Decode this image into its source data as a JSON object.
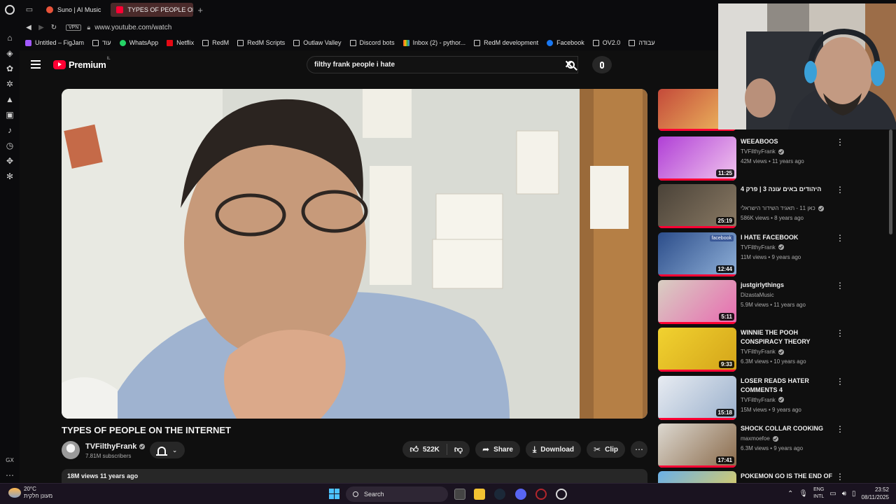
{
  "browser": {
    "tabs": [
      {
        "label": "Suno | AI Music",
        "active": false
      },
      {
        "label": "TYPES OF PEOPLE ON THE INTERNET",
        "active": true
      }
    ],
    "url": "www.youtube.com/watch",
    "vpn_label": "VPN",
    "sidebar_bottom_label": "GX",
    "bookmarks": [
      {
        "label": "Untitled – FigJam",
        "icon": "figjam-icon"
      },
      {
        "label": "עוד",
        "icon": "folder-icon"
      },
      {
        "label": "WhatsApp",
        "icon": "whatsapp-icon"
      },
      {
        "label": "Netflix",
        "icon": "netflix-icon"
      },
      {
        "label": "RedM",
        "icon": "folder-icon"
      },
      {
        "label": "RedM Scripts",
        "icon": "folder-icon"
      },
      {
        "label": "Outlaw Valley",
        "icon": "folder-icon"
      },
      {
        "label": "Discord bots",
        "icon": "folder-icon"
      },
      {
        "label": "Inbox (2) - pythor...",
        "icon": "gmail-icon"
      },
      {
        "label": "RedM development",
        "icon": "folder-icon"
      },
      {
        "label": "Facebook",
        "icon": "facebook-icon"
      },
      {
        "label": "OV2.0",
        "icon": "folder-icon"
      },
      {
        "label": "עבודה",
        "icon": "folder-icon"
      }
    ]
  },
  "youtube": {
    "logo_text": "Premium",
    "logo_region": "IL",
    "search_query": "filthy frank people i hate",
    "video": {
      "title": "TYPES OF PEOPLE ON THE INTERNET",
      "channel": "TVFilthyFrank",
      "subscribers": "7.81M subscribers",
      "likes": "522K",
      "share_label": "Share",
      "download_label": "Download",
      "clip_label": "Clip",
      "views_date": "18M views  11 years ago"
    },
    "recommendations": [
      {
        "title": "WEEABOOS",
        "channel": "TVFilthyFrank",
        "verified": true,
        "meta": "42M views • 11 years ago",
        "duration": "11:25",
        "colors": [
          "#b03fd6",
          "#f2c6ee"
        ]
      },
      {
        "title": "היהודים באים עונה 3 | פרק 4",
        "channel": "כאן 11 - תאגיד השידור הישראלי",
        "verified": true,
        "meta": "586K views • 8 years ago",
        "duration": "25:19",
        "colors": [
          "#4a4238",
          "#8a7a64"
        ]
      },
      {
        "title": "I HATE FACEBOOK",
        "channel": "TVFilthyFrank",
        "verified": true,
        "meta": "11M views • 9 years ago",
        "duration": "12:44",
        "colors": [
          "#2c4d8a",
          "#8fb0d8"
        ],
        "badge": "facebook"
      },
      {
        "title": "justgirlythings",
        "channel": "DizastaMusic",
        "verified": false,
        "meta": "5.9M views • 11 years ago",
        "duration": "5:11",
        "colors": [
          "#d8cfc2",
          "#e86ab0"
        ]
      },
      {
        "title": "WINNIE THE POOH CONSPIRACY THEORY",
        "channel": "TVFilthyFrank",
        "verified": true,
        "meta": "6.3M views • 10 years ago",
        "duration": "9:33",
        "colors": [
          "#f1d230",
          "#d4a419"
        ]
      },
      {
        "title": "LOSER READS HATER COMMENTS 4",
        "channel": "TVFilthyFrank",
        "verified": true,
        "meta": "15M views • 9 years ago",
        "duration": "15:18",
        "colors": [
          "#e8ecf2",
          "#9ab0cc"
        ]
      },
      {
        "title": "SHOCK COLLAR COOKING",
        "channel": "maxmoefoe",
        "verified": true,
        "meta": "6.3M views • 9 years ago",
        "duration": "17:41",
        "colors": [
          "#dcd8d0",
          "#8a6a4a"
        ]
      },
      {
        "title": "POKEMON GO IS THE END OF",
        "channel": "",
        "verified": false,
        "meta": "",
        "duration": "",
        "colors": [
          "#6ab0e8",
          "#f2d24a"
        ]
      }
    ]
  },
  "taskbar": {
    "weather_temp": "20°C",
    "weather_desc": "מעונן חלקית",
    "search_label": "Search",
    "lang_top": "ENG",
    "lang_bottom": "INTL",
    "time": "23:52",
    "date": "08/11/2025"
  }
}
